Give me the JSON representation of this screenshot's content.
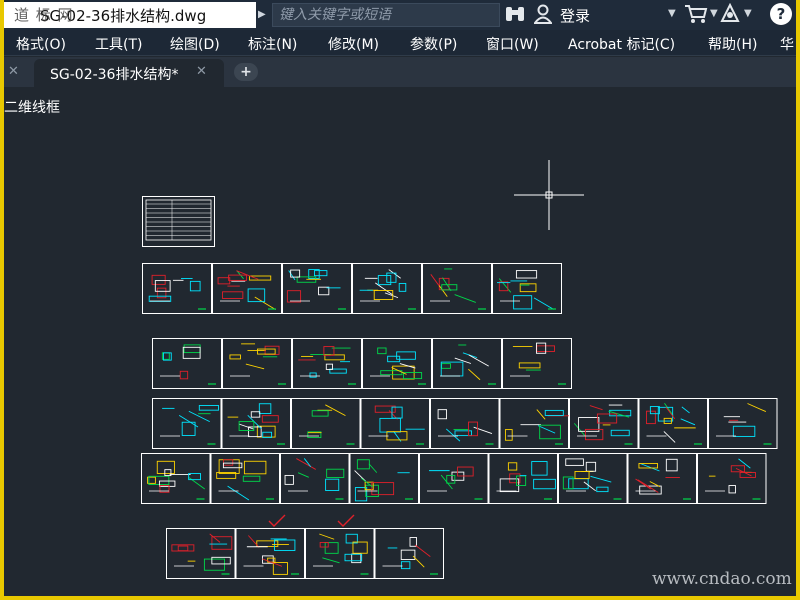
{
  "titlebar": {
    "file_title": "SG-02-36排水结构.dwg",
    "watermark": "道 标 网",
    "search_placeholder": "键入关键字或短语",
    "login_label": "登录"
  },
  "menu": {
    "items": [
      "格式(O)",
      "工具(T)",
      "绘图(D)",
      "标注(N)",
      "修改(M)",
      "参数(P)",
      "窗口(W)",
      "Acrobat 标记(C)",
      "帮助(H)",
      "华"
    ]
  },
  "tabs": {
    "active_label": "SG-02-36排水结构*",
    "close_glyph": "✕",
    "add_glyph": "+"
  },
  "viewport": {
    "view_label": "二维线框",
    "watermark": "www.cndao.com",
    "sheet_rows": [
      1,
      6,
      6,
      9,
      9,
      4
    ],
    "checkmarks": 2
  },
  "colors": {
    "canvas": "#212830",
    "sheet_border": "#ffffff",
    "accent_cyan": "#00e5ff",
    "accent_green": "#00d84a",
    "accent_red": "#e0202a",
    "accent_yellow": "#ffd400",
    "checkmark": "#e0202a",
    "frame_outline": "#e8c800"
  },
  "icons": [
    "binoculars-icon",
    "user-icon",
    "cart-icon",
    "exchange-icon",
    "help-icon",
    "crosshair-cursor"
  ]
}
